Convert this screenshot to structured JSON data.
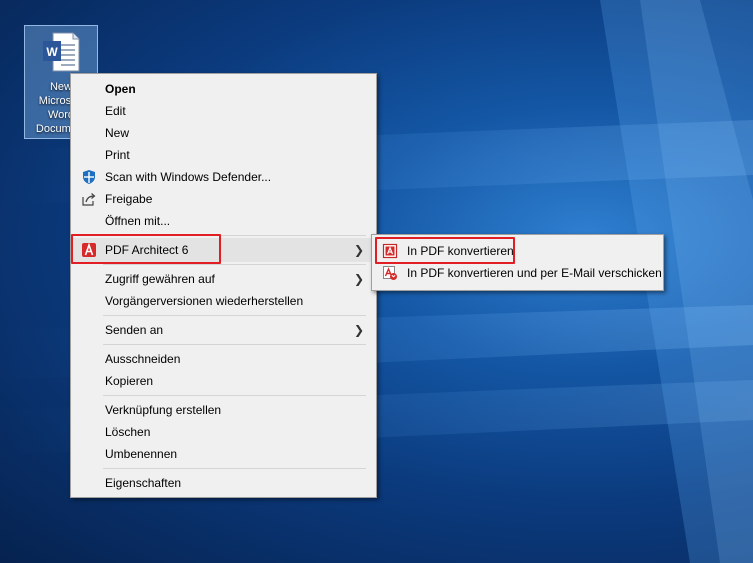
{
  "desktop": {
    "icon": {
      "label": "New\nMicrosoft\nWord\nDocument",
      "icon": "word-document-icon"
    }
  },
  "context_menu": {
    "items": [
      {
        "label": "Open",
        "bold": true
      },
      {
        "label": "Edit"
      },
      {
        "label": "New"
      },
      {
        "label": "Print"
      },
      {
        "label": "Scan with Windows Defender...",
        "icon": "windows-defender-icon"
      },
      {
        "label": "Freigabe",
        "icon": "share-icon"
      },
      {
        "label": "Öffnen mit..."
      },
      {
        "label": "PDF Architect 6",
        "icon": "pdf-architect-icon",
        "has_submenu": true,
        "highlighted": true
      },
      {
        "label": "Zugriff gewähren auf",
        "has_submenu": true
      },
      {
        "label": "Vorgängerversionen wiederherstellen"
      },
      {
        "label": "Senden an",
        "has_submenu": true
      },
      {
        "label": "Ausschneiden"
      },
      {
        "label": "Kopieren"
      },
      {
        "label": "Verknüpfung erstellen"
      },
      {
        "label": "Löschen"
      },
      {
        "label": "Umbenennen"
      },
      {
        "label": "Eigenschaften"
      }
    ]
  },
  "submenu": {
    "items": [
      {
        "label": "In PDF konvertieren",
        "icon": "pdf-convert-icon"
      },
      {
        "label": "In PDF konvertieren und per E-Mail verschicken",
        "icon": "pdf-email-icon"
      }
    ]
  },
  "colors": {
    "highlight_box": "#e01e24",
    "menu_background": "#f0f0f0",
    "desktop_blue": "#0b3a7d"
  }
}
